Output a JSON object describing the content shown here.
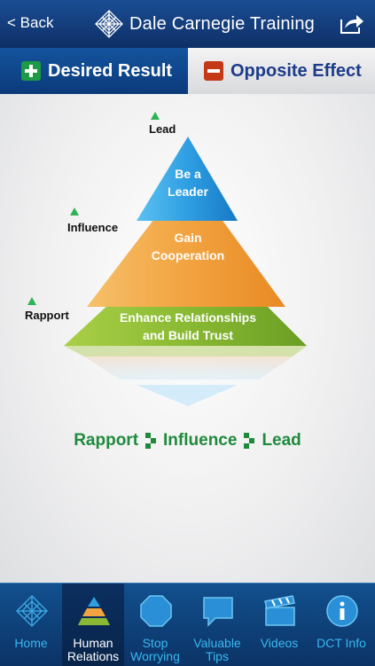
{
  "header": {
    "back_label": "< Back",
    "brand": "Dale Carnegie Training"
  },
  "tabs": {
    "desired": "Desired Result",
    "opposite": "Opposite Effect"
  },
  "pyramid": {
    "levels": [
      {
        "label": "Lead",
        "lines": [
          "Be a",
          "Leader"
        ]
      },
      {
        "label": "Influence",
        "lines": [
          "Gain",
          "Cooperation"
        ]
      },
      {
        "label": "Rapport",
        "lines": [
          "Enhance Relationships",
          "and Build Trust"
        ]
      }
    ],
    "colors": {
      "blue": "#2f9fe2",
      "orange": "#f2a340",
      "green": "#8aba33"
    }
  },
  "slogan": {
    "word1": "Rapport",
    "word2": "Influence",
    "word3": "Lead"
  },
  "tabbar": {
    "items": [
      {
        "label": "Home",
        "icon": "home-icon"
      },
      {
        "label": "Human\nRelations",
        "icon": "pyramid-icon"
      },
      {
        "label": "Stop\nWorrying",
        "icon": "octagon-icon"
      },
      {
        "label": "Valuable\nTips",
        "icon": "speech-bubble-icon"
      },
      {
        "label": "Videos",
        "icon": "clapperboard-icon"
      },
      {
        "label": "DCT Info",
        "icon": "info-icon"
      }
    ]
  }
}
